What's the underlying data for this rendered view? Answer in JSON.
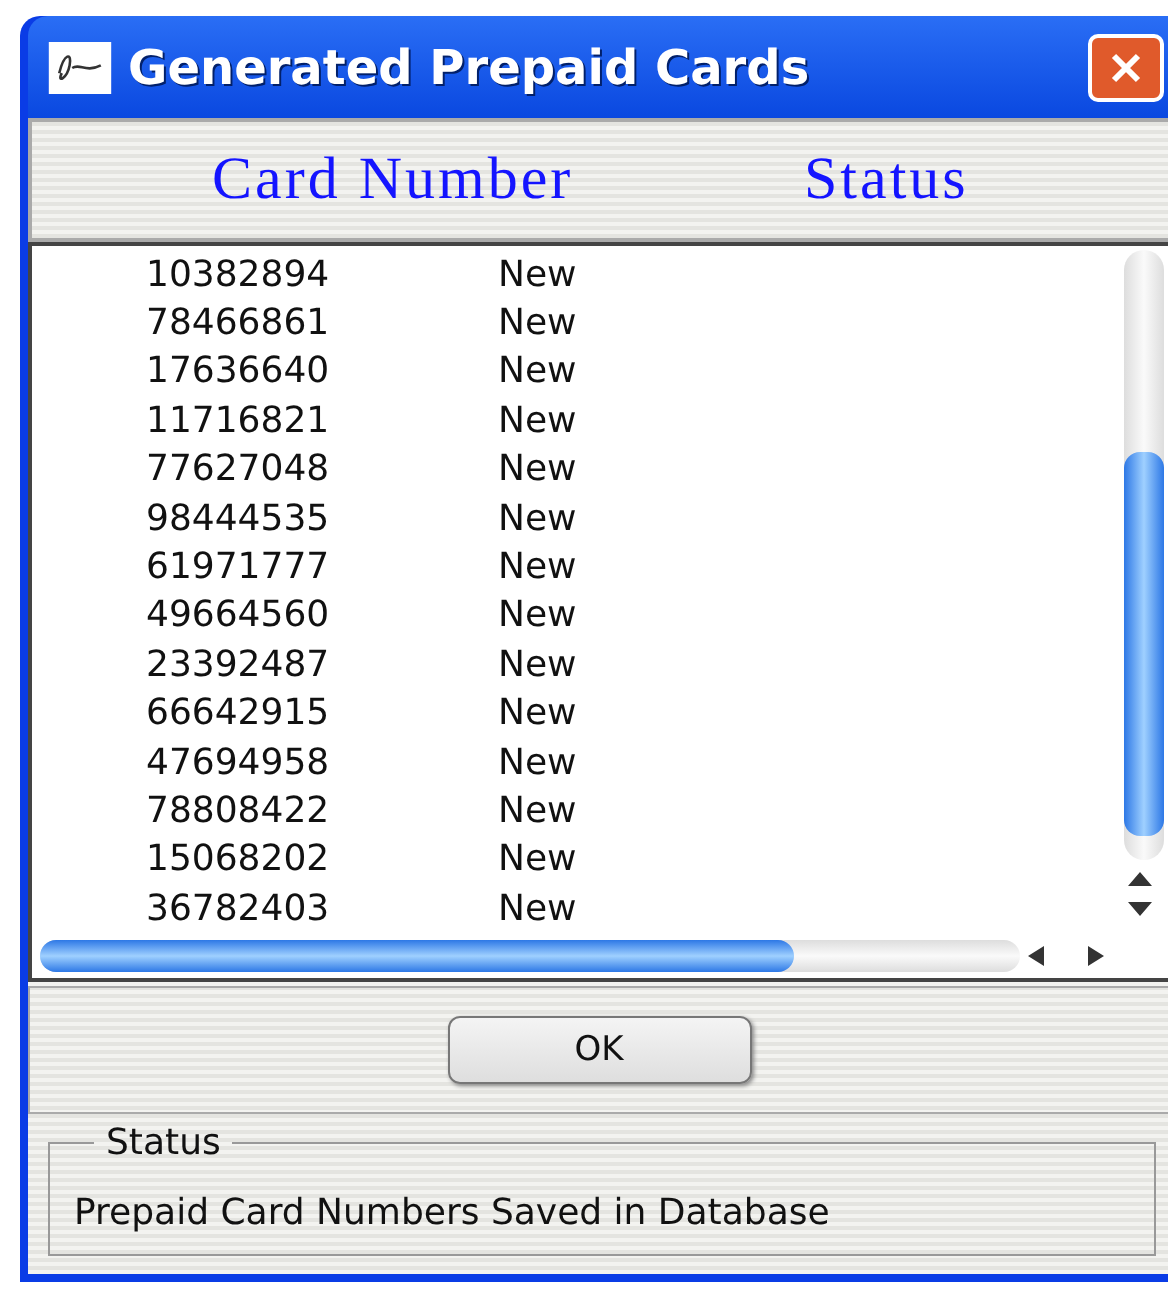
{
  "window": {
    "title": "Generated Prepaid Cards"
  },
  "table": {
    "columns": [
      "Card Number",
      "Status"
    ],
    "rows": [
      {
        "card_number": "10382894",
        "status": "New"
      },
      {
        "card_number": "78466861",
        "status": "New"
      },
      {
        "card_number": "17636640",
        "status": "New"
      },
      {
        "card_number": "11716821",
        "status": "New"
      },
      {
        "card_number": "77627048",
        "status": "New"
      },
      {
        "card_number": "98444535",
        "status": "New"
      },
      {
        "card_number": "61971777",
        "status": "New"
      },
      {
        "card_number": "49664560",
        "status": "New"
      },
      {
        "card_number": "23392487",
        "status": "New"
      },
      {
        "card_number": "66642915",
        "status": "New"
      },
      {
        "card_number": "47694958",
        "status": "New"
      },
      {
        "card_number": "78808422",
        "status": "New"
      },
      {
        "card_number": "15068202",
        "status": "New"
      },
      {
        "card_number": "36782403",
        "status": "New"
      }
    ]
  },
  "buttons": [
    "OK"
  ],
  "status_group": {
    "label": "Status",
    "message": "Prepaid Card Numbers Saved in Database"
  }
}
